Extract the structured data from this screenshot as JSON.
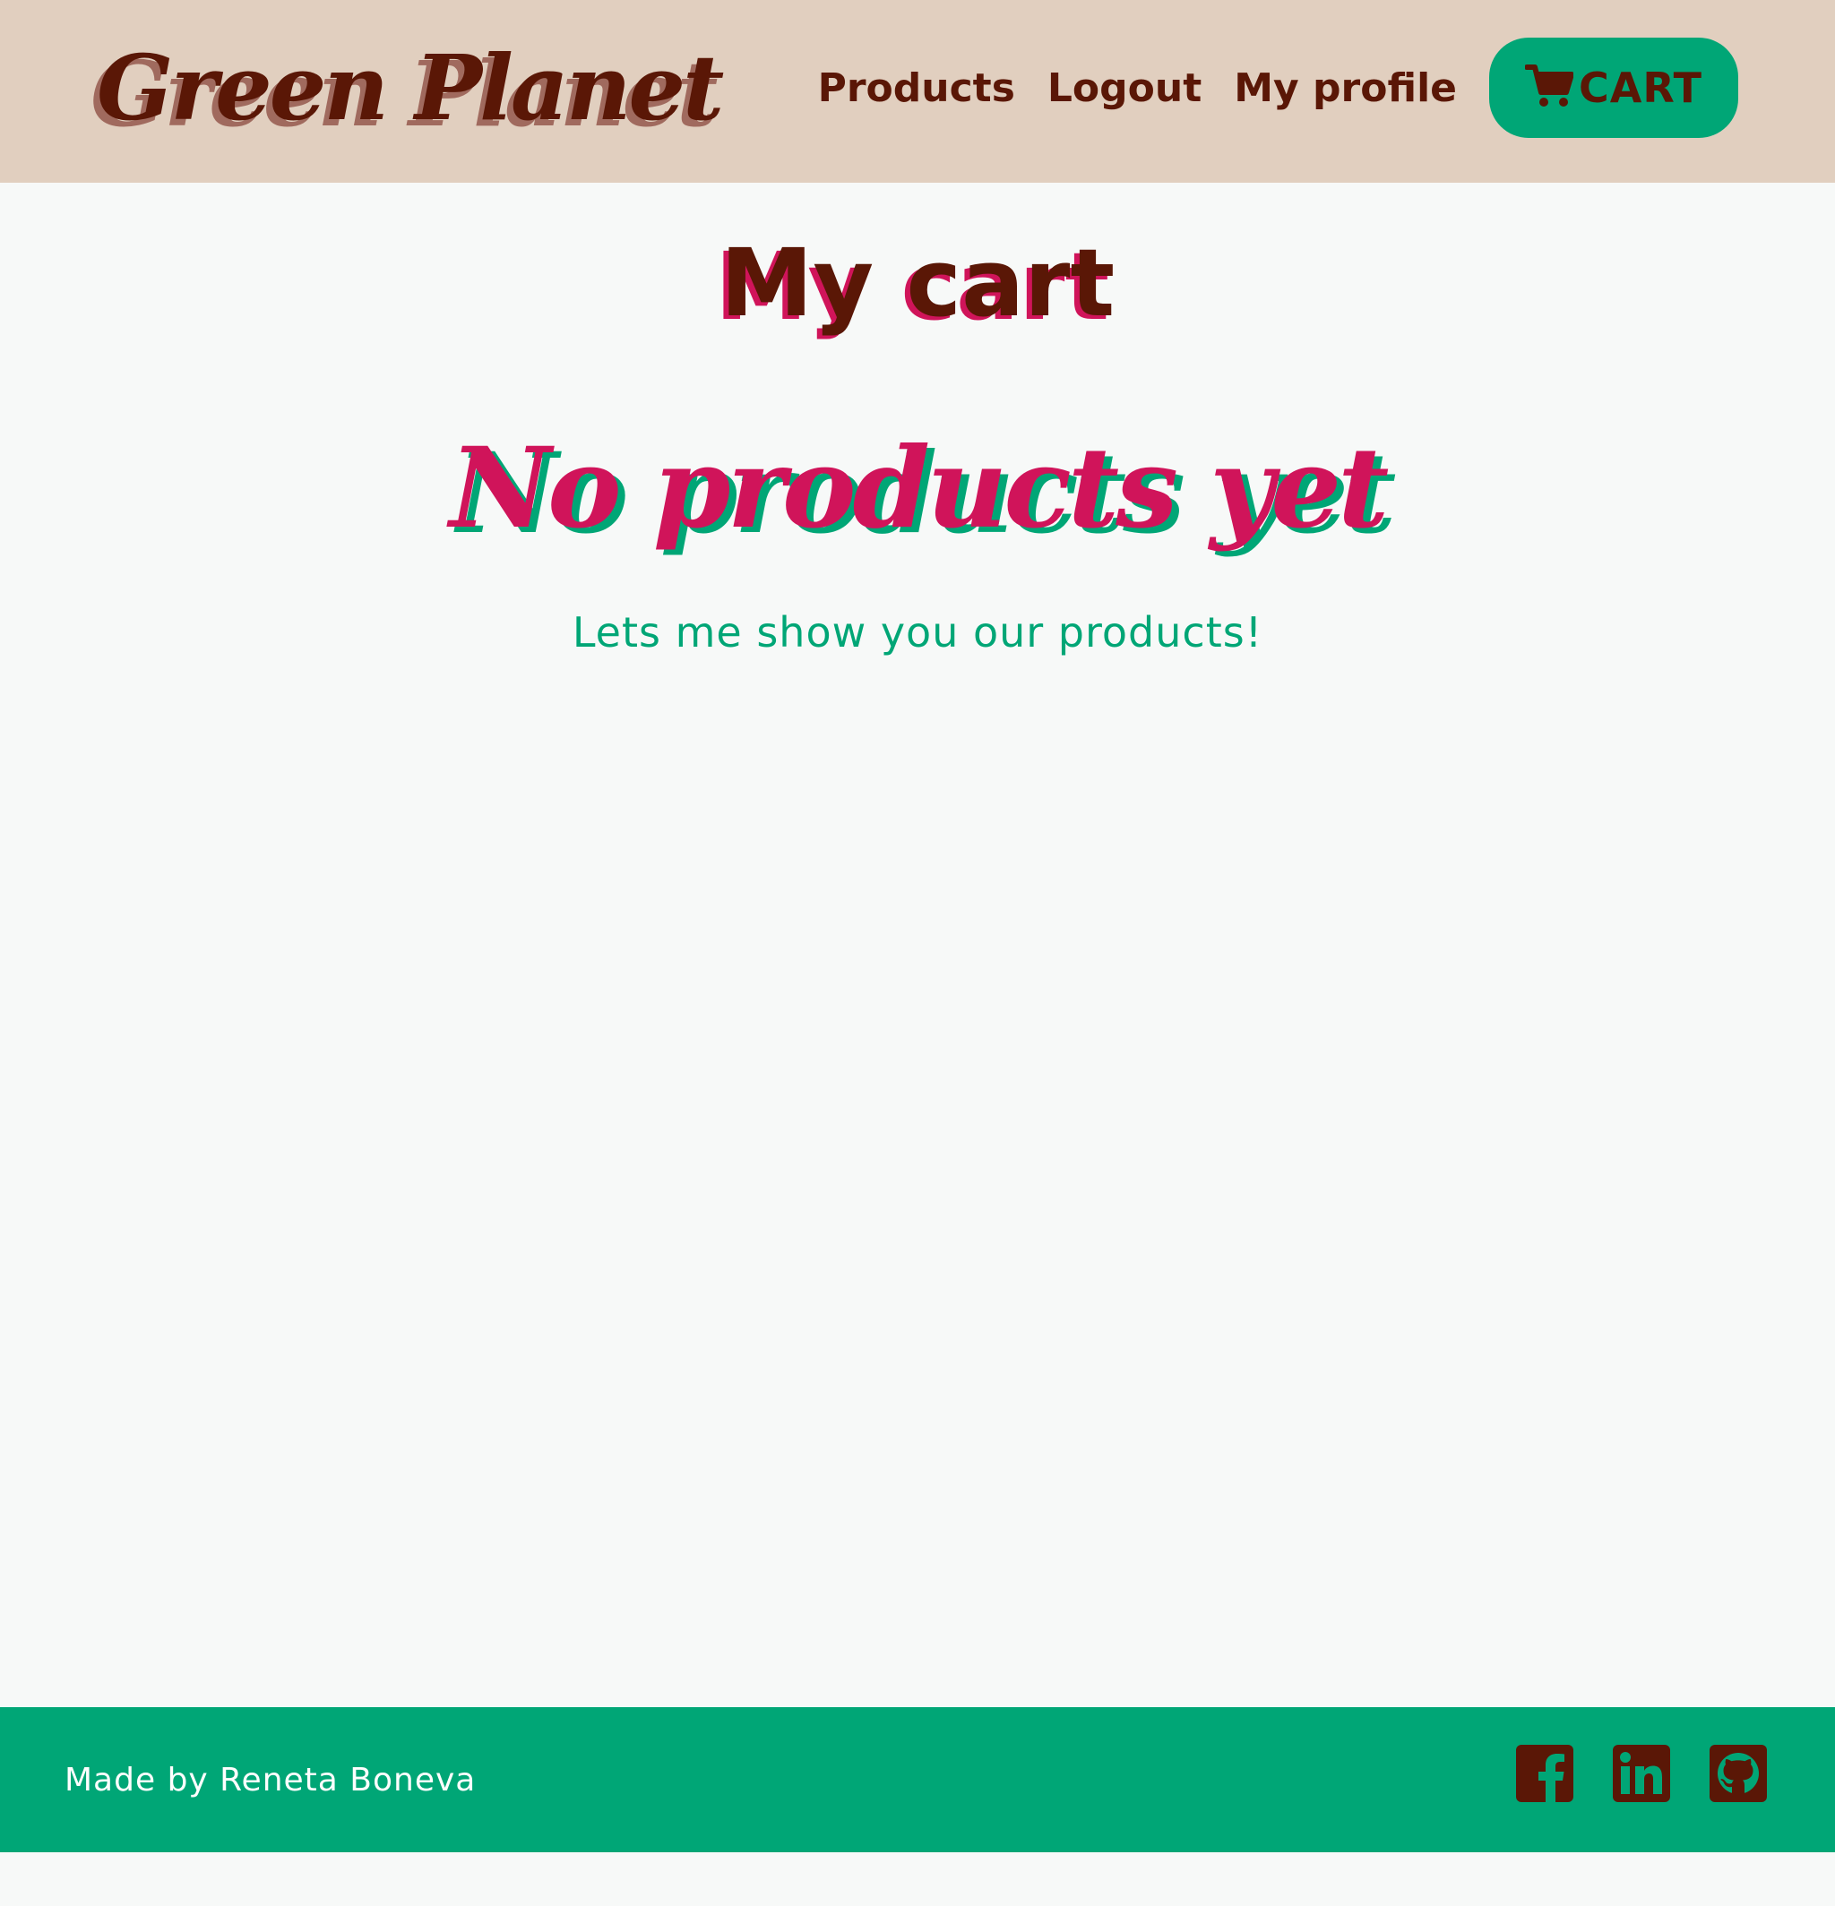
{
  "header": {
    "brand": "Green Planet",
    "nav": {
      "products": "Products",
      "logout": "Logout",
      "profile": "My profile",
      "cart": "CART"
    }
  },
  "main": {
    "title": "My cart",
    "empty_title": "No products yet",
    "empty_subtitle": "Lets me show you our products!"
  },
  "footer": {
    "credit": "Made by Reneta Boneva",
    "socials": [
      "facebook-icon",
      "linkedin-icon",
      "github-icon"
    ]
  },
  "colors": {
    "header_bg": "#e1cfbf",
    "brown": "#5a1706",
    "green": "#00a676",
    "pink": "#d0145a",
    "page_bg": "#f7f9f8"
  }
}
